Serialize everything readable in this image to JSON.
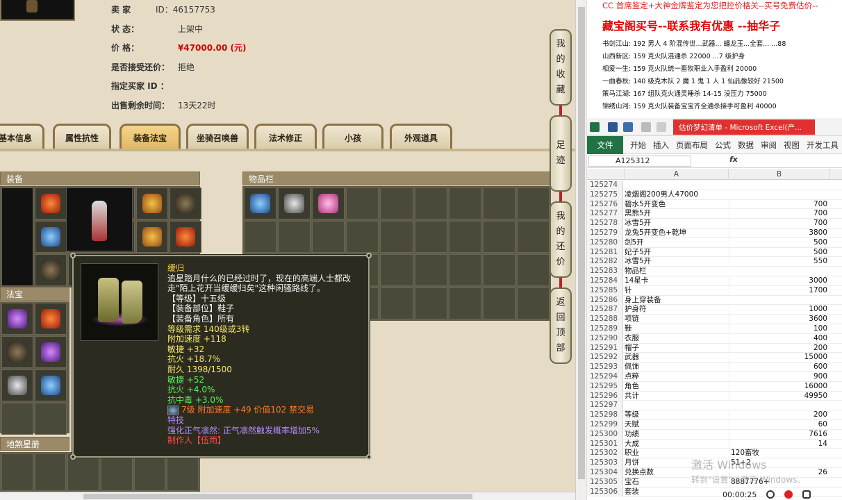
{
  "listing": {
    "seller_label": "卖  家",
    "seller_id": "ID：46157753",
    "status_label": "状      态：",
    "status_value": "上架中",
    "price_label": "价      格：",
    "price_value": "¥47000.00 (元)",
    "counter_label": "是否接受还价：",
    "counter_value": "拒绝",
    "buyer_label": "指定买家 ID ：",
    "buyer_value": "",
    "remain_label": "出售剩余时间：",
    "remain_value": "13天22时"
  },
  "tabs": [
    {
      "label": "基本信息",
      "active": false
    },
    {
      "label": "属性抗性",
      "active": false
    },
    {
      "label": "装备法宝",
      "active": true
    },
    {
      "label": "坐骑召唤兽",
      "active": false
    },
    {
      "label": "法术修正",
      "active": false
    },
    {
      "label": "小孩",
      "active": false
    },
    {
      "label": "外观道具",
      "active": false
    }
  ],
  "panels": {
    "equipment": "装备",
    "inventory": "物品栏",
    "treasure": "法宝",
    "fate": "地煞星册"
  },
  "tooltip": {
    "name": "缓归",
    "desc": "追星踏月什么的已经过时了，现在的高端人士都改走\"陌上花开当缓缓归矣\"这种闲骚路线了。",
    "level": "【等级】十五级",
    "slot": "【装备部位】鞋子",
    "role": "【装备角色】所有",
    "req": "等级需求 140级或3转",
    "speed": "附加速度 +118",
    "agi": "敏捷 +32",
    "fire1": "抗火 +18.7%",
    "durability": "耐久 1398/1500",
    "agi2": "敏捷 +52",
    "fire2": "抗火 +4.0%",
    "poison": "抗中毒 +3.0%",
    "gem_line": "7级 附加速度 +49 价值102 禁交易",
    "skill_label": "特技",
    "skill": "强化正气凛然: 正气凛然触发概率增加5%",
    "maker": "制作人【伍雨】"
  },
  "side_buttons": [
    {
      "label": "我的收藏",
      "chars": [
        "我",
        "的",
        "收",
        "藏"
      ]
    },
    {
      "label": "足迹",
      "chars": [
        "足",
        "迹"
      ]
    },
    {
      "label": "我的还价",
      "chars": [
        "我",
        "的",
        "还",
        "价"
      ]
    },
    {
      "label": "返回顶部",
      "chars": [
        "返",
        "回",
        "顶",
        "部"
      ]
    }
  ],
  "notes": {
    "header": "CC 首席鉴定+大神金牌鉴定为您把控价格关--买号免费估价--",
    "title": "藏宝阁买号--联系我有优惠 --抽华子",
    "lines": [
      "书剑江山: 192 男人 4 阶混传世...武器... 蟠龙玉...全套...  ...88",
      "山西新区: 159 克火队混通杀 22000 ...7 级护身",
      "相爱一生: 159 克火队统一畜牧职业入手盈利 20000",
      "一曲春秋: 140 级克木队 2 魔 1 鬼 1 人 1 仙品像较好 21500",
      "策马江湖: 167 组队克火通灵睡杀 14-15 没压力 75000",
      "锦绣山河: 159 克火队装备宝宝齐全通杀接手可盈利 40000"
    ]
  },
  "excel": {
    "caption": "估价梦幻清单 - Microsoft Excel(产...",
    "ribbon": [
      "文件",
      "开始",
      "插入",
      "页面布局",
      "公式",
      "数据",
      "审阅",
      "视图",
      "开发工具"
    ],
    "namebox": "A125312",
    "fx": "fx",
    "columns": [
      "A",
      "B"
    ],
    "rows": [
      {
        "n": "125274",
        "a": "",
        "b": ""
      },
      {
        "n": "125275",
        "a": "凌烟阁200男人47000",
        "b": ""
      },
      {
        "n": "125276",
        "a": "碧水5开变色",
        "b": "700"
      },
      {
        "n": "125277",
        "a": "黑熊5开",
        "b": "700"
      },
      {
        "n": "125278",
        "a": "冰雪5开",
        "b": "700"
      },
      {
        "n": "125279",
        "a": "龙兔5开变色+乾坤",
        "b": "3800"
      },
      {
        "n": "125280",
        "a": "剑5开",
        "b": "500"
      },
      {
        "n": "125281",
        "a": "妃子5开",
        "b": "500"
      },
      {
        "n": "125282",
        "a": "冰雪5开",
        "b": "550"
      },
      {
        "n": "125283",
        "a": "物品栏",
        "b": ""
      },
      {
        "n": "125284",
        "a": "14星卡",
        "b": "3000"
      },
      {
        "n": "125285",
        "a": "针",
        "b": "1700"
      },
      {
        "n": "125286",
        "a": "身上穿装备",
        "b": ""
      },
      {
        "n": "125287",
        "a": "护身符",
        "b": "1000"
      },
      {
        "n": "125288",
        "a": "项链",
        "b": "3600"
      },
      {
        "n": "125289",
        "a": "鞋",
        "b": "100"
      },
      {
        "n": "125290",
        "a": "衣服",
        "b": "400"
      },
      {
        "n": "125291",
        "a": "帽子",
        "b": "200"
      },
      {
        "n": "125292",
        "a": "武器",
        "b": "15000"
      },
      {
        "n": "125293",
        "a": "佩饰",
        "b": "600"
      },
      {
        "n": "125294",
        "a": "点粹",
        "b": "900"
      },
      {
        "n": "125295",
        "a": "角色",
        "b": "16000"
      },
      {
        "n": "125296",
        "a": "共计",
        "b": "49950"
      },
      {
        "n": "125297",
        "a": "",
        "b": ""
      },
      {
        "n": "125298",
        "a": "等级",
        "b": "200"
      },
      {
        "n": "125299",
        "a": "天赋",
        "b": "60"
      },
      {
        "n": "125300",
        "a": "功绩",
        "b": "7616"
      },
      {
        "n": "125301",
        "a": "大成",
        "b": "14"
      },
      {
        "n": "125302",
        "a": "职业",
        "b": "120畜牧",
        "bl": true
      },
      {
        "n": "125303",
        "a": "月饼",
        "b": "51+2",
        "bl": true
      },
      {
        "n": "125304",
        "a": "兑换点数",
        "b": "26"
      },
      {
        "n": "125305",
        "a": "宝石",
        "b": "8887776+",
        "bl": true
      },
      {
        "n": "125306",
        "a": "套装",
        "b": ""
      }
    ]
  },
  "watermark": {
    "line1": "激活 Windows",
    "line2": "转到\"设置\"以激活 Windows。"
  },
  "recorder": {
    "time": "00:00:25"
  }
}
